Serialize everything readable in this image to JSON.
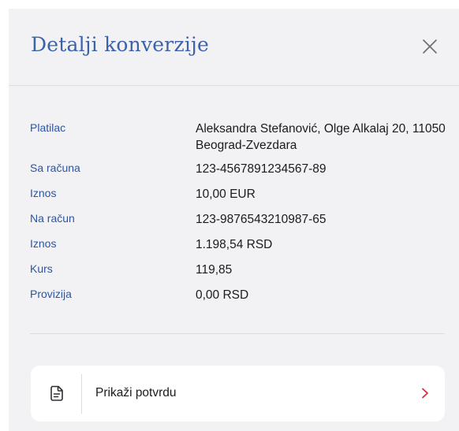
{
  "header": {
    "title": "Detalji konverzije"
  },
  "details": [
    {
      "label": "Platilac",
      "value": "Aleksandra Stefanović, Olge Alkalaj 20, 11050 Beograd-Zvezdara"
    },
    {
      "label": "Sa računa",
      "value": "123-4567891234567-89"
    },
    {
      "label": "Iznos",
      "value": "10,00 EUR"
    },
    {
      "label": "Na račun",
      "value": "123-9876543210987-65"
    },
    {
      "label": "Iznos",
      "value": "1.198,54 RSD"
    },
    {
      "label": "Kurs",
      "value": "119,85"
    },
    {
      "label": "Provizija",
      "value": "0,00 RSD"
    }
  ],
  "receipt": {
    "label": "Prikaži potvrdu"
  },
  "icons": {
    "close": "close-icon",
    "document": "document-icon",
    "chevron": "chevron-right-icon"
  },
  "colors": {
    "accent_blue": "#3b62a8",
    "label_blue": "#2a55a5",
    "chevron_red": "#d6303f",
    "panel_bg": "#f2f2f5"
  }
}
